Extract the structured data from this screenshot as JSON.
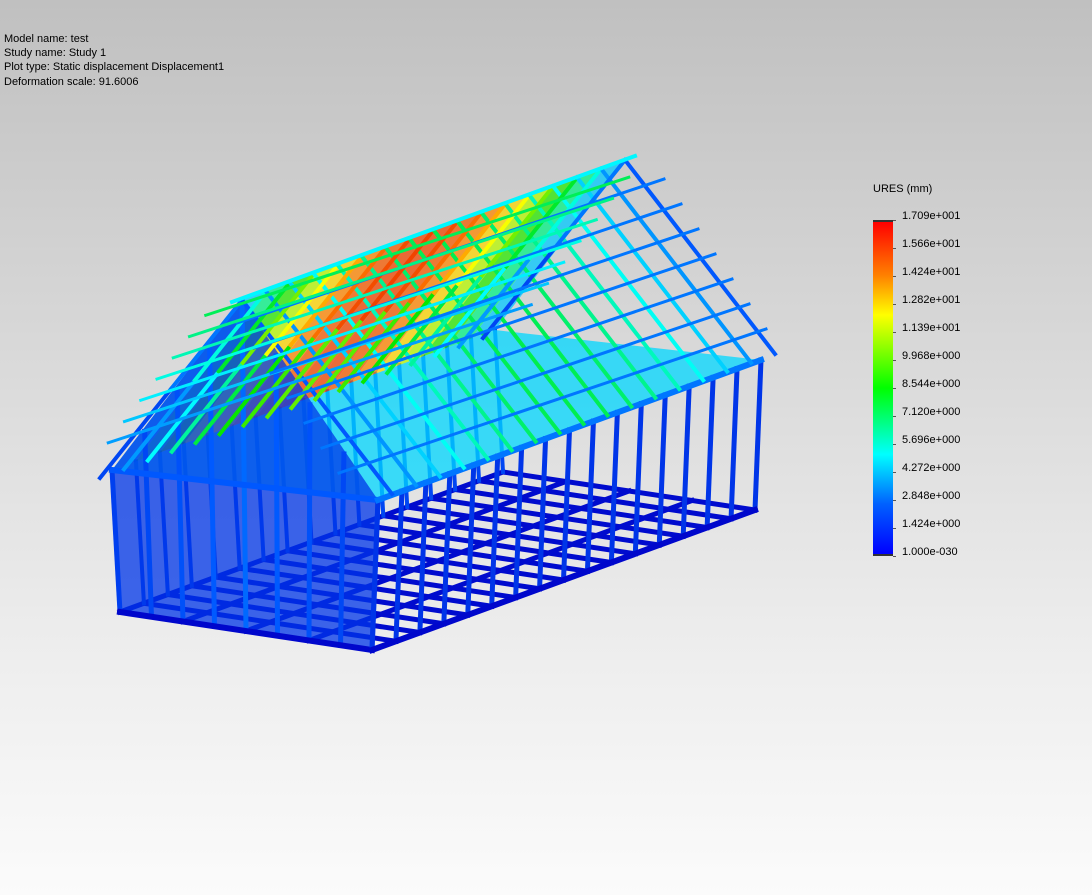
{
  "info": {
    "model_name": "Model name: test",
    "study_name": "Study name: Study 1",
    "plot_type": "Plot type: Static displacement Displacement1",
    "deformation_scale": "Deformation scale: 91.6006"
  },
  "legend": {
    "title": "URES (mm)",
    "labels": [
      "1.709e+001",
      "1.566e+001",
      "1.424e+001",
      "1.282e+001",
      "1.139e+001",
      "9.968e+000",
      "8.544e+000",
      "7.120e+000",
      "5.696e+000",
      "4.272e+000",
      "2.848e+000",
      "1.424e+000",
      "1.000e-030"
    ],
    "max_value": 17.09,
    "min_value": 0
  }
}
